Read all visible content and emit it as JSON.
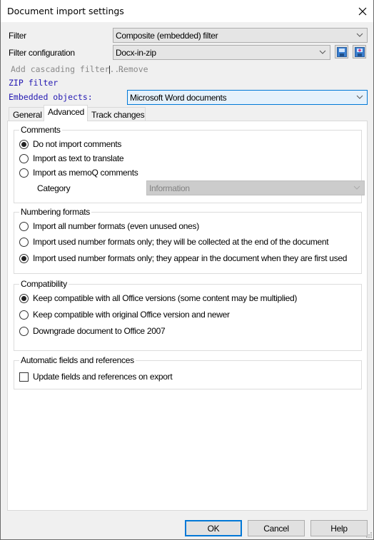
{
  "window": {
    "title": "Document import settings",
    "close_icon": "close-icon"
  },
  "filter": {
    "label": "Filter",
    "value": "Composite (embedded) filter"
  },
  "filter_configuration": {
    "label": "Filter configuration",
    "value": "Docx-in-zip",
    "icons": [
      "save-configuration-icon",
      "save-new-configuration-icon"
    ]
  },
  "cascading": {
    "add_label": "Add cascading filter...",
    "separator": "|",
    "remove_label": "Remove"
  },
  "zip_filter": {
    "label": "ZIP filter"
  },
  "embedded_objects": {
    "label": "Embedded objects:",
    "value": "Microsoft Word documents"
  },
  "tabs": [
    {
      "label": "General",
      "active": false
    },
    {
      "label": "Advanced",
      "active": true
    },
    {
      "label": "Track changes",
      "active": false
    }
  ],
  "comments": {
    "title": "Comments",
    "options": [
      {
        "label": "Do not import comments",
        "checked": true
      },
      {
        "label": "Import as text to translate",
        "checked": false
      },
      {
        "label": "Import as memoQ comments",
        "checked": false
      }
    ],
    "category_label": "Category",
    "category_value": "Information"
  },
  "numbering": {
    "title": "Numbering formats",
    "options": [
      {
        "label": "Import all number formats (even unused ones)",
        "checked": false
      },
      {
        "label": "Import used number formats only; they will be collected at the end of the document",
        "checked": false
      },
      {
        "label": "Import used number formats only; they appear in the document when they are first used",
        "checked": true
      }
    ]
  },
  "compatibility": {
    "title": "Compatibility",
    "options": [
      {
        "label": "Keep compatible with all Office versions (some content may be multiplied)",
        "checked": true
      },
      {
        "label": "Keep compatible with original Office version and newer",
        "checked": false
      },
      {
        "label": "Downgrade document to Office 2007",
        "checked": false
      }
    ]
  },
  "fields": {
    "title": "Automatic fields and references",
    "checkbox_label": "Update fields and references on export",
    "checked": false
  },
  "buttons": {
    "ok": "OK",
    "cancel": "Cancel",
    "help": "Help"
  },
  "colors": {
    "accent": "#0078d7",
    "link_blue": "#2419b2",
    "disabled_text": "#8a8a8a"
  }
}
